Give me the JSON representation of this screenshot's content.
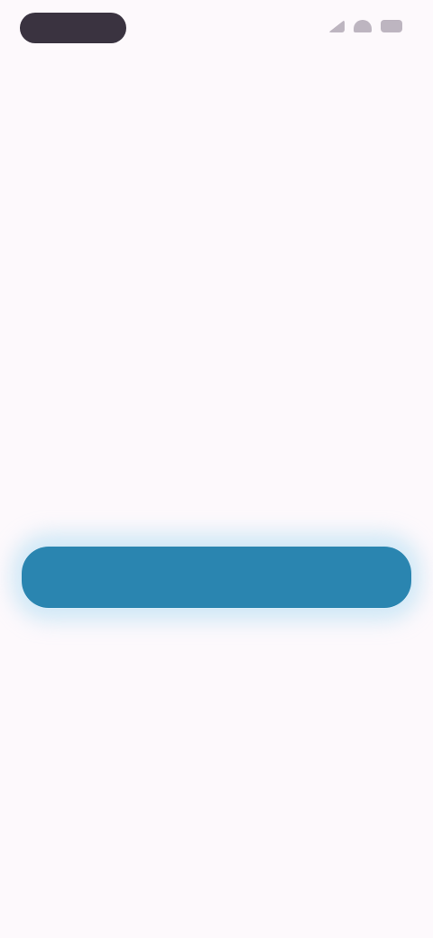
{
  "app": {
    "background": "#fdf9fc",
    "accent": "#2a85b0"
  },
  "status_bar": {
    "icons": [
      "signal-icon",
      "wifi-icon",
      "battery-icon"
    ]
  },
  "content": {
    "eyebrow": "",
    "message": "",
    "cta_label": ""
  }
}
